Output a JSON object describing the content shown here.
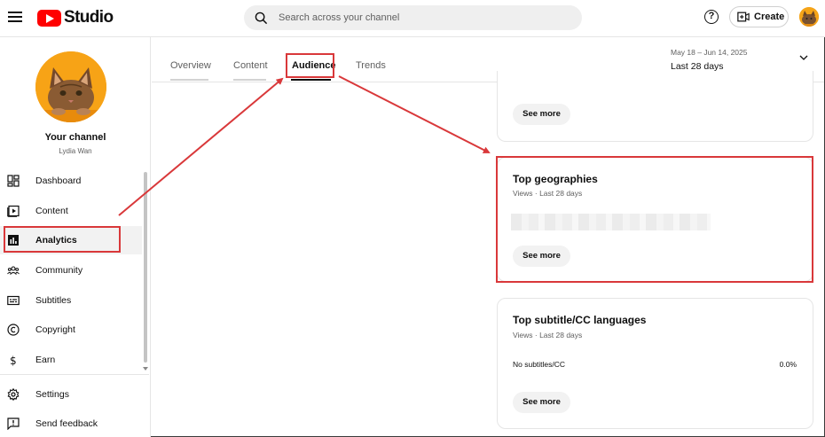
{
  "header": {
    "logo_text": "Studio",
    "search_placeholder": "Search across your channel",
    "help_label": "?",
    "create_label": "Create"
  },
  "sidebar": {
    "channel_title": "Your channel",
    "channel_name": "Lydia Wan",
    "items": [
      {
        "label": "Dashboard",
        "icon": "dashboard-icon"
      },
      {
        "label": "Content",
        "icon": "content-icon"
      },
      {
        "label": "Analytics",
        "icon": "analytics-icon",
        "active": true
      },
      {
        "label": "Community",
        "icon": "community-icon"
      },
      {
        "label": "Subtitles",
        "icon": "subtitles-icon"
      },
      {
        "label": "Copyright",
        "icon": "copyright-icon"
      },
      {
        "label": "Earn",
        "icon": "earn-icon"
      },
      {
        "label": "Settings",
        "icon": "settings-icon"
      },
      {
        "label": "Send feedback",
        "icon": "feedback-icon"
      }
    ]
  },
  "tabs": [
    {
      "label": "Overview"
    },
    {
      "label": "Content"
    },
    {
      "label": "Audience",
      "active": true
    },
    {
      "label": "Trends"
    }
  ],
  "date_range": {
    "range": "May 18 – Jun 14, 2025",
    "label": "Last 28 days"
  },
  "cards": {
    "top_card": {
      "see_more": "See more"
    },
    "geographies": {
      "title": "Top geographies",
      "subtitle": "Views · Last 28 days",
      "see_more": "See more"
    },
    "subtitles": {
      "title": "Top subtitle/CC languages",
      "subtitle": "Views · Last 28 days",
      "row_label": "No subtitles/CC",
      "row_value": "0.0%",
      "see_more": "See more"
    }
  },
  "colors": {
    "brand_red": "#ff0000",
    "annotation_red": "#d9383a",
    "accent_orange": "#f7a316"
  }
}
